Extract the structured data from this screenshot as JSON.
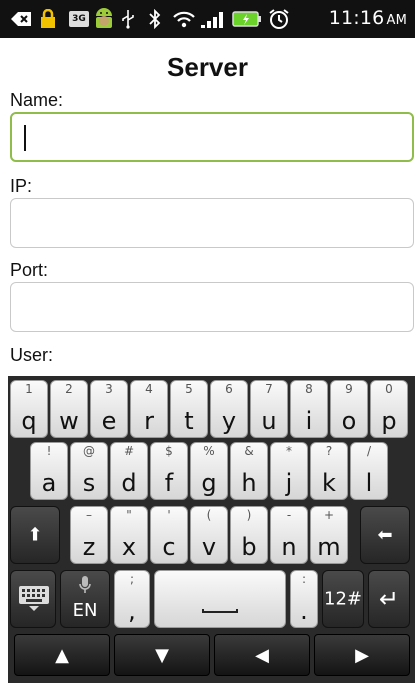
{
  "status_bar": {
    "time": "11:16",
    "ampm": "AM",
    "icons": [
      "back-icon",
      "lock-icon",
      "3g-icon",
      "android-icon",
      "usb-icon",
      "bluetooth-icon",
      "wifi-icon",
      "signal-icon",
      "battery-icon",
      "alarm-icon"
    ],
    "badge_3g": "3G"
  },
  "form": {
    "title": "Server",
    "fields": [
      {
        "label": "Name:",
        "value": ""
      },
      {
        "label": "IP:",
        "value": ""
      },
      {
        "label": "Port:",
        "value": ""
      },
      {
        "label": "User:",
        "value": ""
      }
    ]
  },
  "keyboard": {
    "row1": [
      {
        "alt": "1",
        "main": "q"
      },
      {
        "alt": "2",
        "main": "w"
      },
      {
        "alt": "3",
        "main": "e"
      },
      {
        "alt": "4",
        "main": "r"
      },
      {
        "alt": "5",
        "main": "t"
      },
      {
        "alt": "6",
        "main": "y"
      },
      {
        "alt": "7",
        "main": "u"
      },
      {
        "alt": "8",
        "main": "i"
      },
      {
        "alt": "9",
        "main": "o"
      },
      {
        "alt": "0",
        "main": "p"
      }
    ],
    "row2": [
      {
        "alt": "!",
        "main": "a"
      },
      {
        "alt": "@",
        "main": "s"
      },
      {
        "alt": "#",
        "main": "d"
      },
      {
        "alt": "$",
        "main": "f"
      },
      {
        "alt": "%",
        "main": "g"
      },
      {
        "alt": "&",
        "main": "h"
      },
      {
        "alt": "*",
        "main": "j"
      },
      {
        "alt": "?",
        "main": "k"
      },
      {
        "alt": "/",
        "main": "l"
      }
    ],
    "row3": [
      {
        "alt": "–",
        "main": "z"
      },
      {
        "alt": "\"",
        "main": "x"
      },
      {
        "alt": "'",
        "main": "c"
      },
      {
        "alt": "(",
        "main": "v"
      },
      {
        "alt": ")",
        "main": "b"
      },
      {
        "alt": "-",
        "main": "n"
      },
      {
        "alt": "+",
        "main": "m"
      }
    ],
    "shift_glyph": "⬆",
    "backspace_glyph": "⬅",
    "lang_label": "EN",
    "comma_alt": ";",
    "comma_main": ",",
    "period_alt": ":",
    "period_main": ".",
    "symbols_label": "12#",
    "enter_glyph": "↵",
    "nav": [
      "▲",
      "▼",
      "◀",
      "▶"
    ]
  }
}
